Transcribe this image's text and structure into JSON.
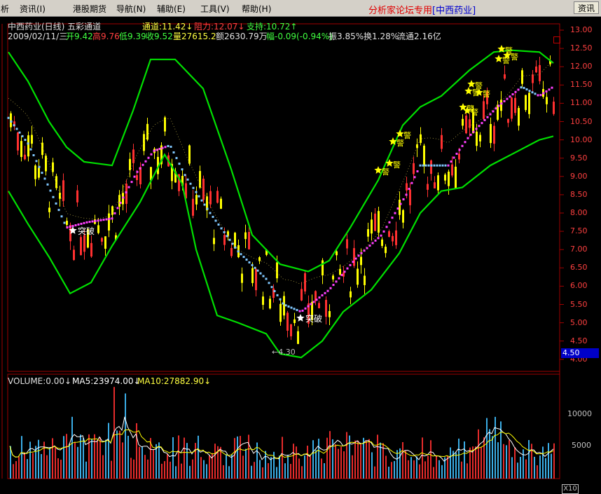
{
  "menu": {
    "items": [
      "析",
      "资讯(I)",
      "港股期货",
      "导航(N)",
      "辅助(E)",
      "工具(V)",
      "帮助(H)"
    ],
    "brand": "分析家论坛专用",
    "stock_tag": "[中西药业]",
    "info_button": "资讯"
  },
  "header": {
    "title": "中西药业(日线) 五彩通道",
    "channel": "通道:11.42↓",
    "resistance": "阻力:12.07↓",
    "support": "支持:10.72↑",
    "date": "2009/02/11/三",
    "open": "开9.42",
    "high": "高9.76",
    "low": "低9.39",
    "close": "收9.52",
    "volume": "量27615.2",
    "amount": "额2630.79万",
    "change": "幅-0.09(-0.94%)",
    "amplitude": "振3.85%",
    "turnover": "换1.28%",
    "float": "流通2.16亿"
  },
  "annotations": {
    "breakout_1": "突破",
    "breakout_2": "突破",
    "low_mark": "←4.30",
    "warning": "警"
  },
  "price_axis": {
    "labels": [
      "13.00",
      "12.50",
      "12.00",
      "11.50",
      "11.00",
      "10.50",
      "10.00",
      "9.50",
      "9.00",
      "8.50",
      "8.00",
      "7.50",
      "7.00",
      "6.50",
      "6.00",
      "5.50",
      "5.00",
      "4.50",
      "4.00"
    ],
    "current": "4.50"
  },
  "volume_panel": {
    "volume": "VOLUME:0.00↓",
    "ma5": "MA5:23974.00↓",
    "ma10": "MA10:27882.90↓",
    "axis": [
      "10000",
      "5000"
    ],
    "scale": "X10"
  },
  "colors": {
    "channel": "#00e000",
    "mid_up": "#ff40ff",
    "mid_down": "#80c8ff",
    "candle_up": "#ff3030",
    "candle_down": "#ffff00",
    "volume_ma5": "#ffffff",
    "volume_ma10": "#ffff00"
  }
}
